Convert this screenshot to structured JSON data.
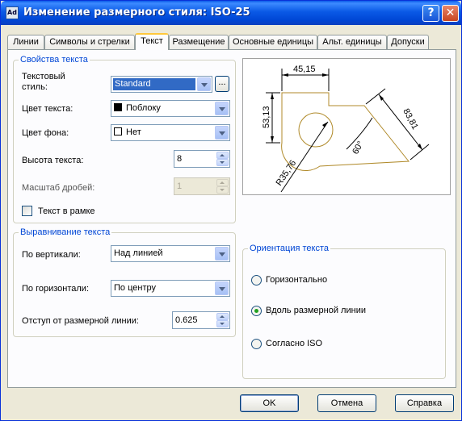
{
  "window": {
    "title": "Изменение размерного стиля: ISO-25",
    "app_icon": "Ad",
    "help_glyph": "?",
    "close_glyph": "✕"
  },
  "tabs": [
    {
      "label": "Линии"
    },
    {
      "label": "Символы и стрелки"
    },
    {
      "label": "Текст",
      "active": true
    },
    {
      "label": "Размещение"
    },
    {
      "label": "Основные единицы"
    },
    {
      "label": "Альт. единицы"
    },
    {
      "label": "Допуски"
    }
  ],
  "text_props": {
    "title": "Свойства текста",
    "style_label_line1": "Текстовый",
    "style_label_line2": "стиль:",
    "style_value": "Standard",
    "browse_label": "...",
    "color_label": "Цвет текста:",
    "color_value": "Поблоку",
    "fill_label": "Цвет фона:",
    "fill_value": "Нет",
    "height_label": "Высота текста:",
    "height_value": "8",
    "fraction_label": "Масштаб дробей:",
    "fraction_value": "1",
    "frame_label": "Текст в рамке"
  },
  "align": {
    "title": "Выравнивание текста",
    "vertical_label": "По вертикали:",
    "vertical_value": "Над линией",
    "horizontal_label": "По горизонтали:",
    "horizontal_value": "По центру",
    "offset_label": "Отступ от размерной линии:",
    "offset_value": "0.625"
  },
  "orientation": {
    "title": "Ориентация текста",
    "options": [
      {
        "label": "Горизонтально",
        "selected": false
      },
      {
        "label": "Вдоль размерной линии",
        "selected": true
      },
      {
        "label": "Согласно ISO",
        "selected": false
      }
    ]
  },
  "preview": {
    "dim_top": "45,15",
    "dim_left": "53,13",
    "dim_right": "83,81",
    "dim_angle": "60°",
    "dim_radius": "R35,76"
  },
  "buttons": {
    "ok": "OK",
    "cancel": "Отмена",
    "help": "Справка"
  },
  "colors": {
    "accent": "#0046d5",
    "titlebar": "#0054e3",
    "tab_highlight": "#ffc83c",
    "selection": "#316ac5"
  }
}
